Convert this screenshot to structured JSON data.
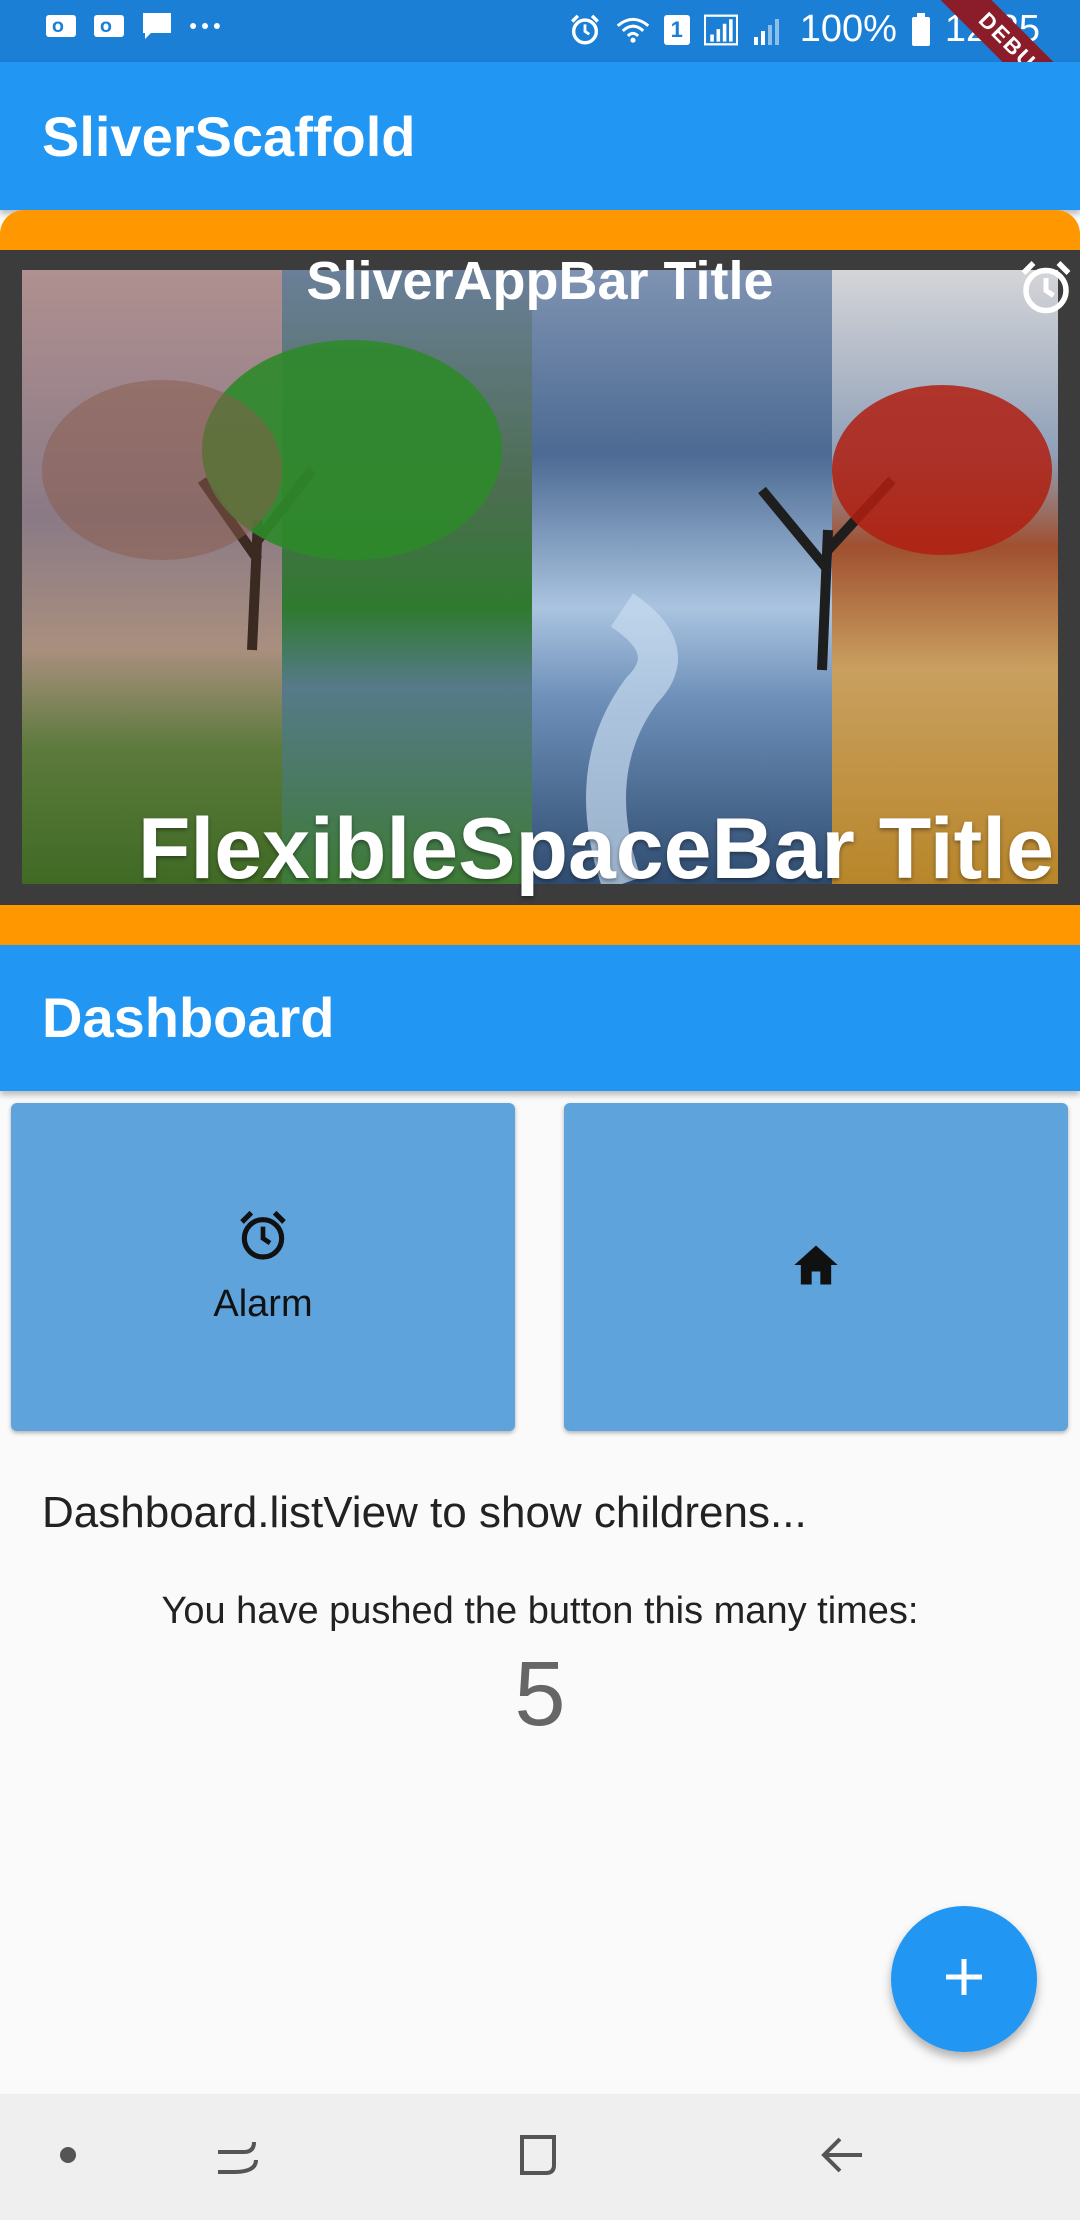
{
  "status_bar": {
    "battery": "100%",
    "time": "12:25",
    "sim_badge": "1",
    "debug_label": "DEBUG",
    "left_icons": [
      "outlook-icon",
      "outlook-icon",
      "message-icon",
      "more-dots-icon"
    ],
    "right_icons": [
      "alarm-icon",
      "wifi-icon",
      "sim-icon",
      "signal-icon",
      "signal-weak-icon",
      "battery-icon"
    ]
  },
  "app_bar": {
    "title": "SliverScaffold"
  },
  "sliver": {
    "appbar_title": "SliverAppBar Title",
    "flexible_title": "FlexibleSpaceBar Title",
    "action_icon": "alarm-icon",
    "colors": {
      "border": "#ff9800",
      "frame": "#3c3c3c"
    }
  },
  "dashboard": {
    "title": "Dashboard",
    "cards": [
      {
        "icon": "alarm-icon",
        "label": "Alarm"
      },
      {
        "icon": "home-icon",
        "label": ""
      }
    ],
    "list_text": "Dashboard.listView to show childrens...",
    "counter_label": "You have pushed the button this many times:",
    "counter_value": "5"
  },
  "fab": {
    "icon": "plus-icon"
  },
  "nav_bar": {
    "icons": [
      "dot-icon",
      "recent-apps-icon",
      "home-square-icon",
      "back-icon"
    ]
  },
  "colors": {
    "primary": "#2196f3",
    "card": "#5ea3dc",
    "background": "#fafafa"
  }
}
